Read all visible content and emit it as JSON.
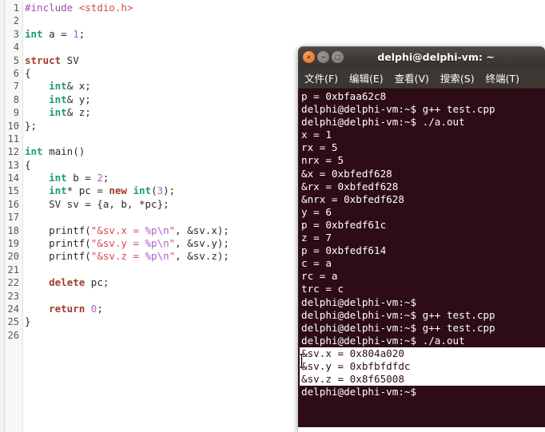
{
  "editor": {
    "name": "source-code-editor",
    "language": "cpp",
    "lines": [
      {
        "n": "1",
        "tokens": [
          {
            "t": "#include ",
            "c": "k-pre"
          },
          {
            "t": "<stdio.h>",
            "c": "k-inc"
          }
        ]
      },
      {
        "n": "2",
        "tokens": []
      },
      {
        "n": "3",
        "tokens": [
          {
            "t": "int",
            "c": "k-type"
          },
          {
            "t": " a = ",
            "c": "k-plain"
          },
          {
            "t": "1",
            "c": "k-num"
          },
          {
            "t": ";",
            "c": "k-plain"
          }
        ]
      },
      {
        "n": "4",
        "tokens": []
      },
      {
        "n": "5",
        "tokens": [
          {
            "t": "struct",
            "c": "k-kw"
          },
          {
            "t": " SV",
            "c": "k-plain"
          }
        ]
      },
      {
        "n": "6",
        "tokens": [
          {
            "t": "{",
            "c": "k-plain"
          }
        ]
      },
      {
        "n": "7",
        "tokens": [
          {
            "t": "    ",
            "c": "k-plain"
          },
          {
            "t": "int",
            "c": "k-type"
          },
          {
            "t": "& x;",
            "c": "k-plain"
          }
        ]
      },
      {
        "n": "8",
        "tokens": [
          {
            "t": "    ",
            "c": "k-plain"
          },
          {
            "t": "int",
            "c": "k-type"
          },
          {
            "t": "& y;",
            "c": "k-plain"
          }
        ]
      },
      {
        "n": "9",
        "tokens": [
          {
            "t": "    ",
            "c": "k-plain"
          },
          {
            "t": "int",
            "c": "k-type"
          },
          {
            "t": "& z;",
            "c": "k-plain"
          }
        ]
      },
      {
        "n": "10",
        "tokens": [
          {
            "t": "};",
            "c": "k-plain"
          }
        ]
      },
      {
        "n": "11",
        "tokens": []
      },
      {
        "n": "12",
        "tokens": [
          {
            "t": "int",
            "c": "k-type"
          },
          {
            "t": " main()",
            "c": "k-plain"
          }
        ]
      },
      {
        "n": "13",
        "tokens": [
          {
            "t": "{",
            "c": "k-plain"
          }
        ]
      },
      {
        "n": "14",
        "tokens": [
          {
            "t": "    ",
            "c": "k-plain"
          },
          {
            "t": "int",
            "c": "k-type"
          },
          {
            "t": " b = ",
            "c": "k-plain"
          },
          {
            "t": "2",
            "c": "k-num"
          },
          {
            "t": ";",
            "c": "k-plain"
          }
        ]
      },
      {
        "n": "15",
        "tokens": [
          {
            "t": "    ",
            "c": "k-plain"
          },
          {
            "t": "int",
            "c": "k-type"
          },
          {
            "t": "* pc = ",
            "c": "k-plain"
          },
          {
            "t": "new",
            "c": "k-kw"
          },
          {
            "t": " ",
            "c": "k-plain"
          },
          {
            "t": "int",
            "c": "k-type"
          },
          {
            "t": "(",
            "c": "k-plain"
          },
          {
            "t": "3",
            "c": "k-num"
          },
          {
            "t": ");",
            "c": "k-plain"
          }
        ]
      },
      {
        "n": "16",
        "tokens": [
          {
            "t": "    SV sv = {a, b, *pc};",
            "c": "k-plain"
          }
        ]
      },
      {
        "n": "17",
        "tokens": []
      },
      {
        "n": "18",
        "tokens": [
          {
            "t": "    printf(",
            "c": "k-plain"
          },
          {
            "t": "\"&sv.x = ",
            "c": "k-str"
          },
          {
            "t": "%p\\n",
            "c": "k-esc"
          },
          {
            "t": "\"",
            "c": "k-str"
          },
          {
            "t": ", &sv.x);",
            "c": "k-plain"
          }
        ]
      },
      {
        "n": "19",
        "tokens": [
          {
            "t": "    printf(",
            "c": "k-plain"
          },
          {
            "t": "\"&sv.y = ",
            "c": "k-str"
          },
          {
            "t": "%p\\n",
            "c": "k-esc"
          },
          {
            "t": "\"",
            "c": "k-str"
          },
          {
            "t": ", &sv.y);",
            "c": "k-plain"
          }
        ]
      },
      {
        "n": "20",
        "tokens": [
          {
            "t": "    printf(",
            "c": "k-plain"
          },
          {
            "t": "\"&sv.z = ",
            "c": "k-str"
          },
          {
            "t": "%p\\n",
            "c": "k-esc"
          },
          {
            "t": "\"",
            "c": "k-str"
          },
          {
            "t": ", &sv.z);",
            "c": "k-plain"
          }
        ]
      },
      {
        "n": "21",
        "tokens": []
      },
      {
        "n": "22",
        "tokens": [
          {
            "t": "    ",
            "c": "k-plain"
          },
          {
            "t": "delete",
            "c": "k-kw"
          },
          {
            "t": " pc;",
            "c": "k-plain"
          }
        ]
      },
      {
        "n": "23",
        "tokens": []
      },
      {
        "n": "24",
        "tokens": [
          {
            "t": "    ",
            "c": "k-plain"
          },
          {
            "t": "return",
            "c": "k-kw"
          },
          {
            "t": " ",
            "c": "k-plain"
          },
          {
            "t": "0",
            "c": "k-num"
          },
          {
            "t": ";",
            "c": "k-plain"
          }
        ]
      },
      {
        "n": "25",
        "tokens": [
          {
            "t": "}",
            "c": "k-plain"
          }
        ]
      },
      {
        "n": "26",
        "tokens": []
      }
    ]
  },
  "terminal": {
    "title": "delphi@delphi-vm: ~",
    "window_buttons": [
      {
        "name": "close-button",
        "glyph": "×"
      },
      {
        "name": "minimize-button",
        "glyph": "−"
      },
      {
        "name": "maximize-button",
        "glyph": "□"
      }
    ],
    "menu": [
      {
        "label": "文件(F)"
      },
      {
        "label": "编辑(E)"
      },
      {
        "label": "查看(V)"
      },
      {
        "label": "搜索(S)"
      },
      {
        "label": "终端(T)"
      }
    ],
    "colors": {
      "background": "#2d0c18",
      "foreground": "#ffffff",
      "titlebar": "#3c3733",
      "selection_bg": "#ffffff",
      "selection_fg": "#2d0c18"
    },
    "lines": [
      {
        "text": "p = 0xbfaa62c8",
        "state": "normal"
      },
      {
        "text": "delphi@delphi-vm:~$ g++ test.cpp",
        "state": "normal"
      },
      {
        "text": "delphi@delphi-vm:~$ ./a.out",
        "state": "normal"
      },
      {
        "text": "x = 1",
        "state": "normal"
      },
      {
        "text": "rx = 5",
        "state": "normal"
      },
      {
        "text": "nrx = 5",
        "state": "normal"
      },
      {
        "text": "&x = 0xbfedf628",
        "state": "normal"
      },
      {
        "text": "&rx = 0xbfedf628",
        "state": "normal"
      },
      {
        "text": "&nrx = 0xbfedf628",
        "state": "normal"
      },
      {
        "text": "y = 6",
        "state": "normal"
      },
      {
        "text": "p = 0xbfedf61c",
        "state": "normal"
      },
      {
        "text": "z = 7",
        "state": "normal"
      },
      {
        "text": "p = 0xbfedf614",
        "state": "normal"
      },
      {
        "text": "c = a",
        "state": "normal"
      },
      {
        "text": "rc = a",
        "state": "normal"
      },
      {
        "text": "trc = c",
        "state": "normal"
      },
      {
        "text": "delphi@delphi-vm:~$",
        "state": "normal"
      },
      {
        "text": "delphi@delphi-vm:~$ g++ test.cpp",
        "state": "normal"
      },
      {
        "text": "delphi@delphi-vm:~$ g++ test.cpp",
        "state": "normal"
      },
      {
        "text": "delphi@delphi-vm:~$ ./a.out",
        "state": "normal"
      },
      {
        "text": "&sv.x = 0x804a020",
        "state": "selected"
      },
      {
        "text": "&sv.y = 0xbfbfdfdc",
        "state": "selected"
      },
      {
        "text": "&sv.z = 0x8f65008",
        "state": "selected"
      },
      {
        "text": "delphi@delphi-vm:~$",
        "state": "promptrow"
      }
    ]
  },
  "cursor": {
    "name": "text-ibeam-cursor"
  }
}
